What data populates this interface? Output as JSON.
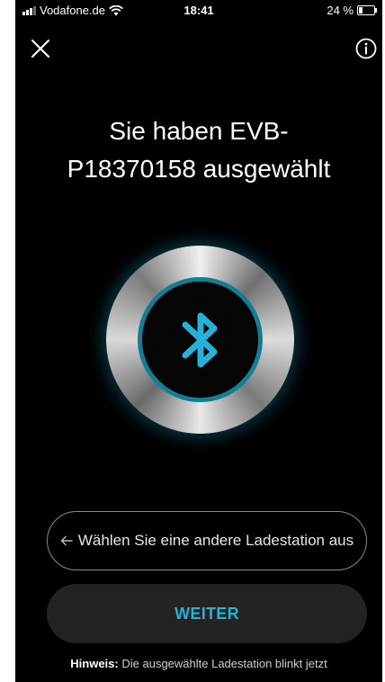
{
  "status_bar": {
    "carrier": "Vodafone.de",
    "time": "18:41",
    "battery": "24 %"
  },
  "header": {
    "close_icon": "close-icon",
    "info_icon": "info-icon"
  },
  "title": {
    "line1": "Sie haben EVB-",
    "line2": "P18370158 ausgewählt"
  },
  "bluetooth": {
    "icon": "bluetooth-icon",
    "accent_color": "#26b1d8"
  },
  "buttons": {
    "choose_other": "Wählen Sie eine andere Ladestation aus",
    "next": "WEITER"
  },
  "hint": {
    "label": "Hinweis:",
    "text": "Die ausgewählte Ladestation blinkt jetzt"
  }
}
